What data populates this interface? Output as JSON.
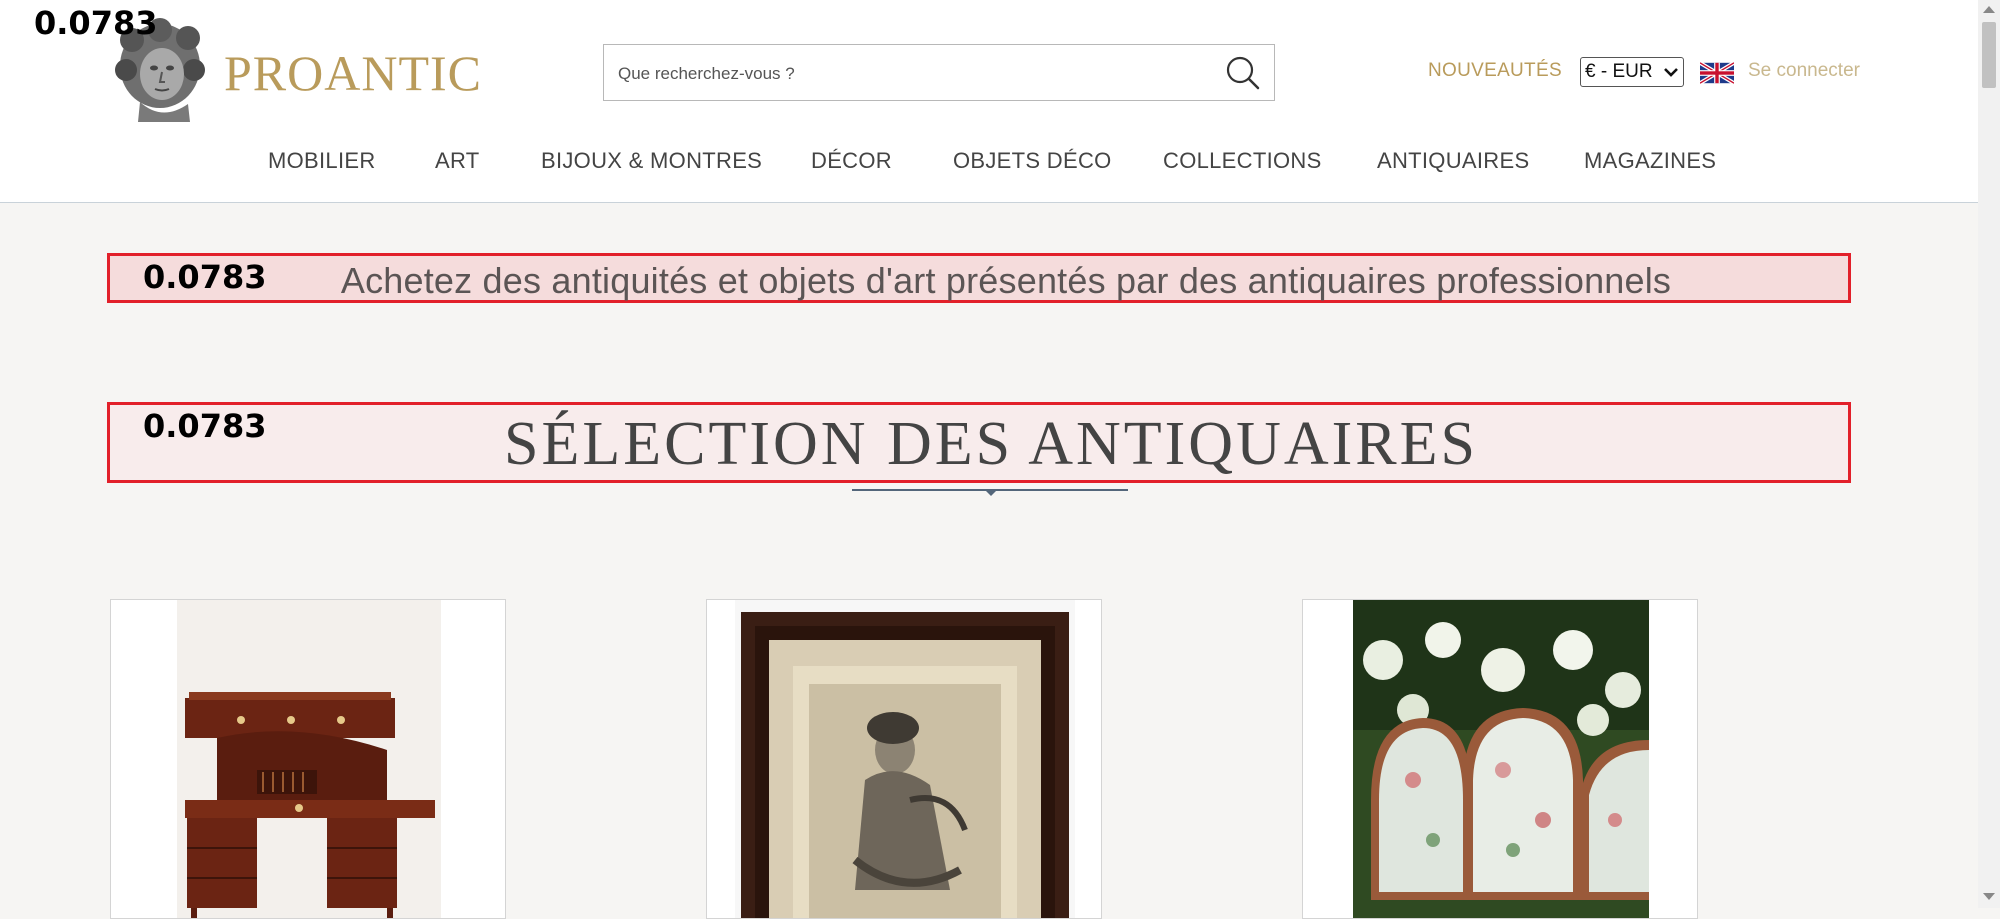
{
  "overlay_scores": [
    "0.0783",
    "0.0783",
    "0.0783"
  ],
  "brand": {
    "name": "PROANTIC"
  },
  "search": {
    "placeholder": "Que recherchez-vous ?"
  },
  "header": {
    "nouveautes": "NOUVEAUTÉS",
    "currency": "€ - EUR",
    "language_flag": "uk-flag-icon",
    "login": "Se connecter"
  },
  "nav": [
    "MOBILIER",
    "ART",
    "BIJOUX & MONTRES",
    "DÉCOR",
    "OBJETS DÉCO",
    "COLLECTIONS",
    "ANTIQUAIRES",
    "MAGAZINES"
  ],
  "tagline": "Achetez des antiquités et objets d'art présentés par des antiquaires professionnels",
  "section_title": "SÉLECTION DES ANTIQUAIRES",
  "products": [
    {
      "image": "mahogany-roll-top-desk"
    },
    {
      "image": "framed-portrait-drawing"
    },
    {
      "image": "floral-upholstered-armchairs-in-garden"
    }
  ],
  "colors": {
    "brand_gold": "#b99b5b",
    "highlight_red": "#e2202a",
    "nav_text": "#444444"
  }
}
